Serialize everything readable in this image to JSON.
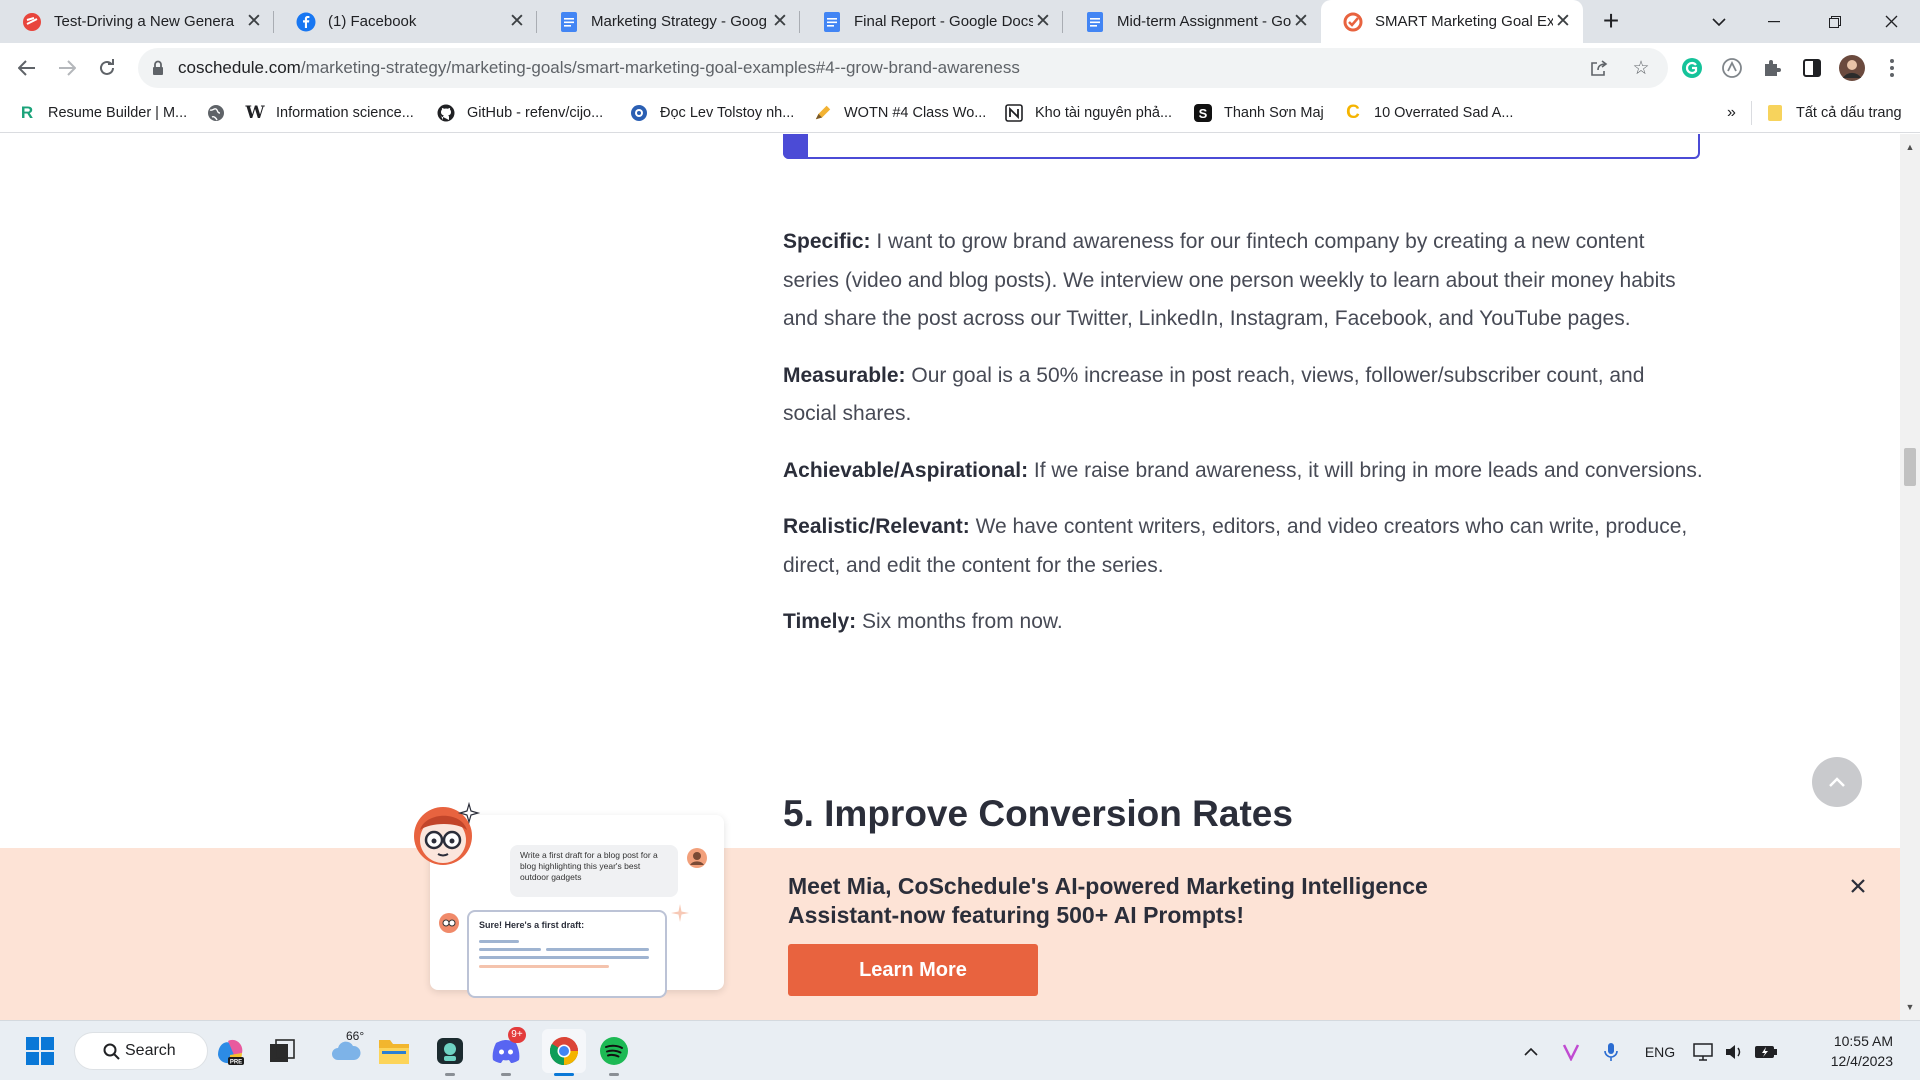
{
  "browser": {
    "tabs": [
      {
        "label": "Test-Driving a New Genera",
        "icon": "red-mark-icon",
        "active": false
      },
      {
        "label": "(1) Facebook",
        "icon": "facebook-icon",
        "active": false
      },
      {
        "label": "Marketing Strategy - Goog",
        "icon": "google-docs-icon",
        "active": false
      },
      {
        "label": "Final Report - Google Docs",
        "icon": "google-docs-icon",
        "active": false
      },
      {
        "label": "Mid-term Assignment - Go",
        "icon": "google-docs-icon",
        "active": false
      },
      {
        "label": "SMART Marketing Goal Ex",
        "icon": "coschedule-icon",
        "active": true
      }
    ],
    "url_host": "coschedule.com",
    "url_path": "/marketing-strategy/marketing-goals/smart-marketing-goal-examples#4--grow-brand-awareness",
    "bookmarks": [
      {
        "label": "Resume Builder | M...",
        "icon": "resume-builder-icon"
      },
      {
        "label": "",
        "icon": "globe-icon"
      },
      {
        "label": "Information science...",
        "icon": "wikipedia-icon"
      },
      {
        "label": "GitHub - refenv/cijo...",
        "icon": "github-icon"
      },
      {
        "label": "Đọc Lev Tolstoy nh...",
        "icon": "blue-circle-icon"
      },
      {
        "label": "WOTN #4 Class Wo...",
        "icon": "pencil-icon"
      },
      {
        "label": "Kho tài nguyên phả...",
        "icon": "notion-icon"
      },
      {
        "label": "Thanh Sơn Maj",
        "icon": "s-logo-icon"
      },
      {
        "label": "10 Overrated Sad A...",
        "icon": "c-logo-icon"
      }
    ],
    "bookmarks_overflow": "»",
    "all_bookmarks": "Tất cả dấu trang"
  },
  "article": {
    "specific_label": "Specific:",
    "specific_text": " I want to grow brand awareness for our fintech company by creating a new content series (video and blog posts). We interview one person weekly to learn about their money habits and share the post across our Twitter, LinkedIn, Instagram, Facebook, and YouTube pages.",
    "measurable_label": "Measurable:",
    "measurable_text": " Our goal is a 50% increase in post reach, views, follower/subscriber count, and social shares.",
    "achievable_label": "Achievable/Aspirational:",
    "achievable_text": " If we raise brand awareness, it will bring in more leads and conversions.",
    "realistic_label": "Realistic/Relevant:",
    "realistic_text": " We have content writers, editors, and video creators who can write, produce, direct, and edit the content for the series.",
    "timely_label": "Timely:",
    "timely_text": " Six months from now.",
    "next_heading": "5. Improve Conversion Rates"
  },
  "banner": {
    "title": "Meet Mia, CoSchedule's AI-powered Marketing Intelligence Assistant-now featuring 500+ AI Prompts!",
    "button": "Learn More",
    "chat_prompt": "Write a first draft for a blog post for a blog highlighting this year's best outdoor gadgets",
    "chat_reply": "Sure! Here's a first draft:"
  },
  "taskbar": {
    "search_label": "Search",
    "weather_temp": "66°",
    "discord_badge": "9+",
    "language": "ENG",
    "time": "10:55 AM",
    "date": "12/4/2023"
  },
  "colors": {
    "accent": "#4b4bd6",
    "banner_bg": "#fde3d6",
    "cta": "#e8633f"
  }
}
